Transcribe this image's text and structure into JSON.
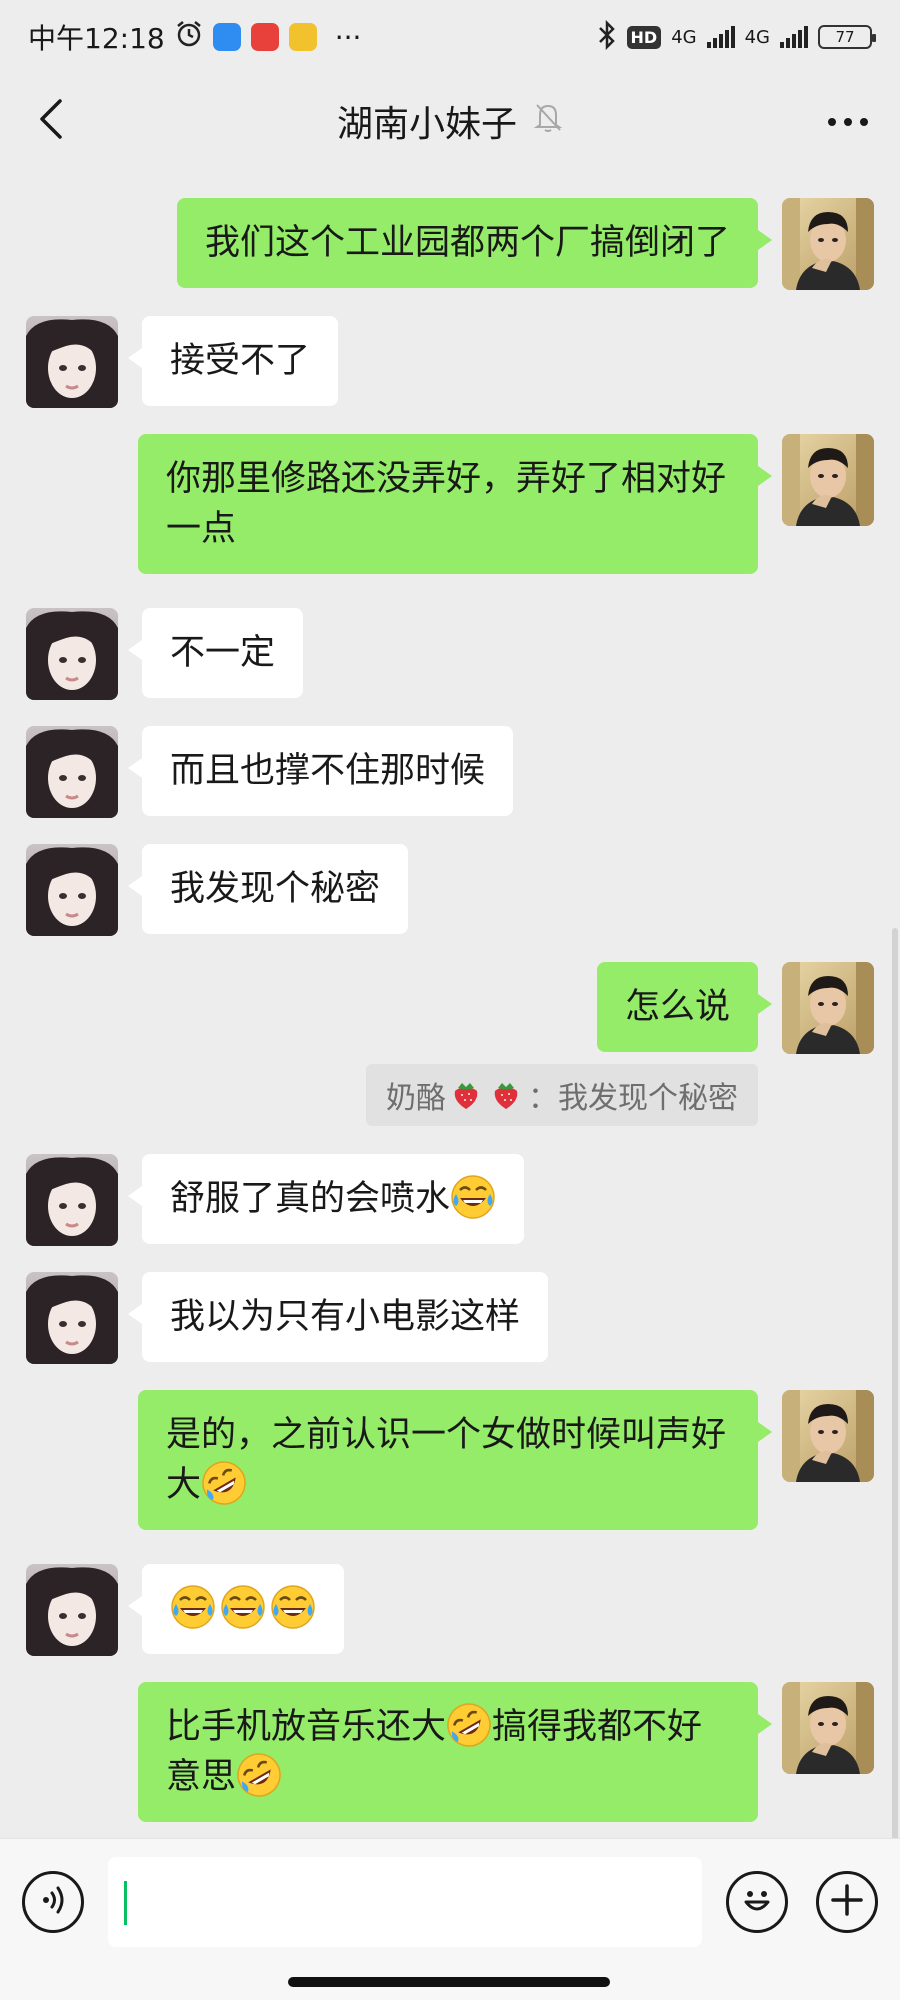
{
  "status_bar": {
    "time": "中午12:18",
    "more": "···",
    "hd": "HD",
    "network_1": "4G",
    "network_2": "4G",
    "battery": "77",
    "icons": [
      "alarm-icon",
      "app-blue-icon",
      "app-red-icon",
      "app-yellow-icon",
      "bluetooth-icon",
      "signal-icon"
    ]
  },
  "header": {
    "title": "湖南小妹子",
    "icons": [
      "back-chevron-icon",
      "mute-bell-icon",
      "more-dots-icon"
    ]
  },
  "messages": [
    {
      "side": "right",
      "text": "我们这个工业园都两个厂搞倒闭了"
    },
    {
      "side": "left",
      "text": "接受不了"
    },
    {
      "side": "right",
      "text": "你那里修路还没弄好，弄好了相对好一点"
    },
    {
      "side": "left",
      "text": "不一定"
    },
    {
      "side": "left",
      "text": "而且也撑不住那时候"
    },
    {
      "side": "left",
      "text": "我发现个秘密"
    },
    {
      "side": "right",
      "text": "怎么说"
    },
    {
      "side": "left",
      "text": "舒服了真的会喷水",
      "emoji": "laugh-cry"
    },
    {
      "side": "left",
      "text": "我以为只有小电影这样"
    },
    {
      "side": "right",
      "text": "是的，之前认识一个女做时候叫声好大",
      "emoji": "rofl"
    },
    {
      "side": "left",
      "text": "",
      "emoji": "laugh-cry x3"
    },
    {
      "side": "right",
      "text_1": "比手机放音乐还大",
      "text_2": "搞得我都不好意思",
      "emoji": "rofl"
    }
  ],
  "quote": {
    "name": "奶酪",
    "separator": "：",
    "text": "我发现个秘密",
    "emoji": "strawberry x2"
  },
  "input_bar": {
    "value": "",
    "icons": [
      "voice-icon",
      "emoji-face-icon",
      "plus-icon"
    ]
  }
}
